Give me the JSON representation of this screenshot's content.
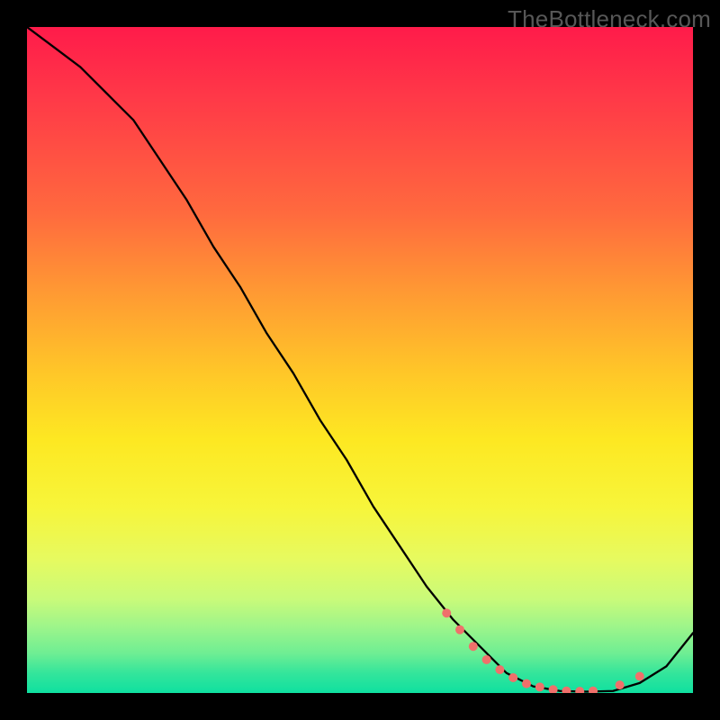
{
  "watermark": "TheBottleneck.com",
  "chart_data": {
    "type": "line",
    "title": "",
    "xlabel": "",
    "ylabel": "",
    "xlim": [
      0,
      100
    ],
    "ylim": [
      0,
      100
    ],
    "grid": false,
    "legend": false,
    "series": [
      {
        "name": "curve",
        "color": "#000000",
        "x": [
          0,
          4,
          8,
          12,
          16,
          20,
          24,
          28,
          32,
          36,
          40,
          44,
          48,
          52,
          56,
          60,
          64,
          68,
          72,
          76,
          80,
          84,
          88,
          92,
          96,
          100
        ],
        "y": [
          100,
          97,
          94,
          90,
          86,
          80,
          74,
          67,
          61,
          54,
          48,
          41,
          35,
          28,
          22,
          16,
          11,
          7,
          3,
          1,
          0.3,
          0.2,
          0.3,
          1.5,
          4,
          9
        ]
      }
    ],
    "markers": {
      "name": "highlight-points",
      "color": "#f0706b",
      "radius_px": 5,
      "x": [
        63,
        65,
        67,
        69,
        71,
        73,
        75,
        77,
        79,
        81,
        83,
        85,
        89,
        92
      ],
      "y": [
        12,
        9.5,
        7,
        5,
        3.5,
        2.3,
        1.4,
        0.9,
        0.5,
        0.3,
        0.25,
        0.3,
        1.2,
        2.5
      ]
    },
    "background_gradient": {
      "direction": "vertical",
      "stops": [
        {
          "pos": 0.0,
          "color": "#ff1b4a"
        },
        {
          "pos": 0.28,
          "color": "#ff6a3e"
        },
        {
          "pos": 0.52,
          "color": "#ffc728"
        },
        {
          "pos": 0.72,
          "color": "#f7f53a"
        },
        {
          "pos": 0.9,
          "color": "#9ef58a"
        },
        {
          "pos": 1.0,
          "color": "#0fe0a0"
        }
      ]
    }
  }
}
